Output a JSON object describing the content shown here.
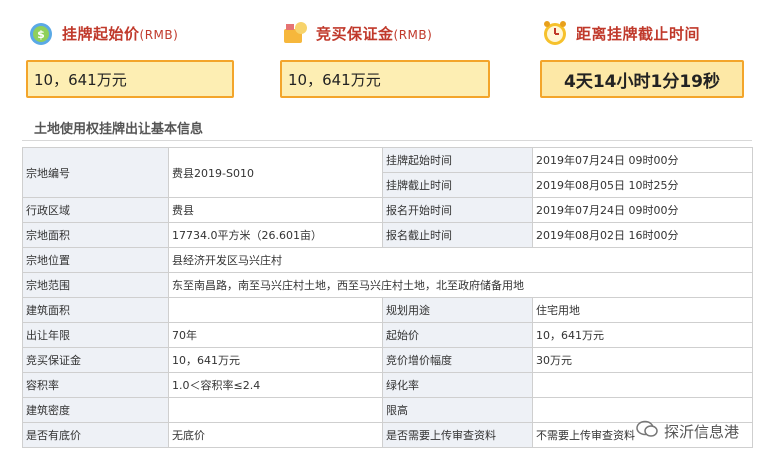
{
  "summary": {
    "start_price": {
      "label": "挂牌起始价",
      "unit": "(RMB)",
      "value": "10，641万元"
    },
    "deposit": {
      "label": "竞买保证金",
      "unit": "(RMB)",
      "value": "10，641万元"
    },
    "countdown": {
      "label": "距离挂牌截止时间",
      "value": "4天14小时1分19秒"
    }
  },
  "section_title": "土地使用权挂牌出让基本信息",
  "info": {
    "parcel_no_label": "宗地编号",
    "parcel_no": "费县2019-S010",
    "list_start_label": "挂牌起始时间",
    "list_start": "2019年07月24日 09时00分",
    "list_end_label": "挂牌截止时间",
    "list_end": "2019年08月05日 10时25分",
    "district_label": "行政区域",
    "district": "费县",
    "reg_start_label": "报名开始时间",
    "reg_start": "2019年07月24日 09时00分",
    "area_label": "宗地面积",
    "area": "17734.0平方米（26.601亩）",
    "reg_end_label": "报名截止时间",
    "reg_end": "2019年08月02日 16时00分",
    "location_label": "宗地位置",
    "location": "县经济开发区马兴庄村",
    "scope_label": "宗地范围",
    "scope": "东至南昌路，南至马兴庄村土地，西至马兴庄村土地，北至政府储备用地",
    "build_area_label": "建筑面积",
    "build_area": "",
    "use_label": "规划用途",
    "use": "住宅用地",
    "term_label": "出让年限",
    "term": "70年",
    "start_price_label": "起始价",
    "start_price": "10，641万元",
    "deposit_label": "竞买保证金",
    "deposit": "10，641万元",
    "increment_label": "竞价增价幅度",
    "increment": "30万元",
    "far_label": "容积率",
    "far": "1.0＜容积率≤2.4",
    "green_label": "绿化率",
    "green": "",
    "density_label": "建筑密度",
    "density": "",
    "height_label": "限高",
    "height": "",
    "reserve_label": "是否有底价",
    "reserve": "无底价",
    "review_label": "是否需要上传审查资料",
    "review": "不需要上传审查资料"
  },
  "watermark": "探沂信息港",
  "colors": {
    "title_red": "#c0392b",
    "box_border": "#f3a52b",
    "box_fill": "#fdeeb3",
    "key_cell": "#eef1f6"
  }
}
